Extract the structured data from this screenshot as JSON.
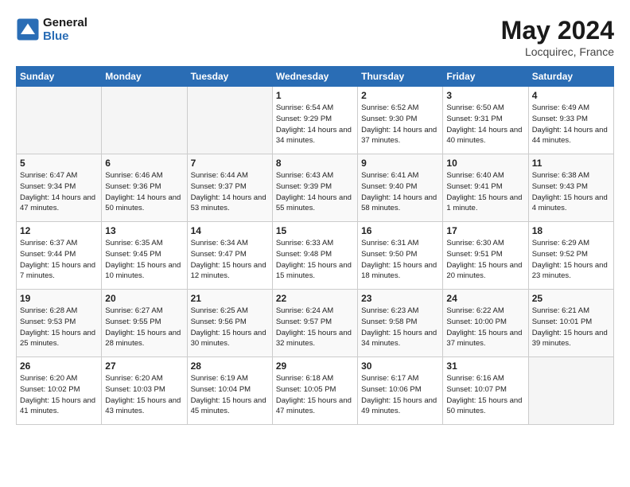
{
  "header": {
    "logo_line1": "General",
    "logo_line2": "Blue",
    "month_year": "May 2024",
    "location": "Locquirec, France"
  },
  "weekdays": [
    "Sunday",
    "Monday",
    "Tuesday",
    "Wednesday",
    "Thursday",
    "Friday",
    "Saturday"
  ],
  "weeks": [
    [
      {
        "day": "",
        "empty": true
      },
      {
        "day": "",
        "empty": true
      },
      {
        "day": "",
        "empty": true
      },
      {
        "day": "1",
        "sunrise": "Sunrise: 6:54 AM",
        "sunset": "Sunset: 9:29 PM",
        "daylight": "Daylight: 14 hours and 34 minutes."
      },
      {
        "day": "2",
        "sunrise": "Sunrise: 6:52 AM",
        "sunset": "Sunset: 9:30 PM",
        "daylight": "Daylight: 14 hours and 37 minutes."
      },
      {
        "day": "3",
        "sunrise": "Sunrise: 6:50 AM",
        "sunset": "Sunset: 9:31 PM",
        "daylight": "Daylight: 14 hours and 40 minutes."
      },
      {
        "day": "4",
        "sunrise": "Sunrise: 6:49 AM",
        "sunset": "Sunset: 9:33 PM",
        "daylight": "Daylight: 14 hours and 44 minutes."
      }
    ],
    [
      {
        "day": "5",
        "sunrise": "Sunrise: 6:47 AM",
        "sunset": "Sunset: 9:34 PM",
        "daylight": "Daylight: 14 hours and 47 minutes."
      },
      {
        "day": "6",
        "sunrise": "Sunrise: 6:46 AM",
        "sunset": "Sunset: 9:36 PM",
        "daylight": "Daylight: 14 hours and 50 minutes."
      },
      {
        "day": "7",
        "sunrise": "Sunrise: 6:44 AM",
        "sunset": "Sunset: 9:37 PM",
        "daylight": "Daylight: 14 hours and 53 minutes."
      },
      {
        "day": "8",
        "sunrise": "Sunrise: 6:43 AM",
        "sunset": "Sunset: 9:39 PM",
        "daylight": "Daylight: 14 hours and 55 minutes."
      },
      {
        "day": "9",
        "sunrise": "Sunrise: 6:41 AM",
        "sunset": "Sunset: 9:40 PM",
        "daylight": "Daylight: 14 hours and 58 minutes."
      },
      {
        "day": "10",
        "sunrise": "Sunrise: 6:40 AM",
        "sunset": "Sunset: 9:41 PM",
        "daylight": "Daylight: 15 hours and 1 minute."
      },
      {
        "day": "11",
        "sunrise": "Sunrise: 6:38 AM",
        "sunset": "Sunset: 9:43 PM",
        "daylight": "Daylight: 15 hours and 4 minutes."
      }
    ],
    [
      {
        "day": "12",
        "sunrise": "Sunrise: 6:37 AM",
        "sunset": "Sunset: 9:44 PM",
        "daylight": "Daylight: 15 hours and 7 minutes."
      },
      {
        "day": "13",
        "sunrise": "Sunrise: 6:35 AM",
        "sunset": "Sunset: 9:45 PM",
        "daylight": "Daylight: 15 hours and 10 minutes."
      },
      {
        "day": "14",
        "sunrise": "Sunrise: 6:34 AM",
        "sunset": "Sunset: 9:47 PM",
        "daylight": "Daylight: 15 hours and 12 minutes."
      },
      {
        "day": "15",
        "sunrise": "Sunrise: 6:33 AM",
        "sunset": "Sunset: 9:48 PM",
        "daylight": "Daylight: 15 hours and 15 minutes."
      },
      {
        "day": "16",
        "sunrise": "Sunrise: 6:31 AM",
        "sunset": "Sunset: 9:50 PM",
        "daylight": "Daylight: 15 hours and 18 minutes."
      },
      {
        "day": "17",
        "sunrise": "Sunrise: 6:30 AM",
        "sunset": "Sunset: 9:51 PM",
        "daylight": "Daylight: 15 hours and 20 minutes."
      },
      {
        "day": "18",
        "sunrise": "Sunrise: 6:29 AM",
        "sunset": "Sunset: 9:52 PM",
        "daylight": "Daylight: 15 hours and 23 minutes."
      }
    ],
    [
      {
        "day": "19",
        "sunrise": "Sunrise: 6:28 AM",
        "sunset": "Sunset: 9:53 PM",
        "daylight": "Daylight: 15 hours and 25 minutes."
      },
      {
        "day": "20",
        "sunrise": "Sunrise: 6:27 AM",
        "sunset": "Sunset: 9:55 PM",
        "daylight": "Daylight: 15 hours and 28 minutes."
      },
      {
        "day": "21",
        "sunrise": "Sunrise: 6:25 AM",
        "sunset": "Sunset: 9:56 PM",
        "daylight": "Daylight: 15 hours and 30 minutes."
      },
      {
        "day": "22",
        "sunrise": "Sunrise: 6:24 AM",
        "sunset": "Sunset: 9:57 PM",
        "daylight": "Daylight: 15 hours and 32 minutes."
      },
      {
        "day": "23",
        "sunrise": "Sunrise: 6:23 AM",
        "sunset": "Sunset: 9:58 PM",
        "daylight": "Daylight: 15 hours and 34 minutes."
      },
      {
        "day": "24",
        "sunrise": "Sunrise: 6:22 AM",
        "sunset": "Sunset: 10:00 PM",
        "daylight": "Daylight: 15 hours and 37 minutes."
      },
      {
        "day": "25",
        "sunrise": "Sunrise: 6:21 AM",
        "sunset": "Sunset: 10:01 PM",
        "daylight": "Daylight: 15 hours and 39 minutes."
      }
    ],
    [
      {
        "day": "26",
        "sunrise": "Sunrise: 6:20 AM",
        "sunset": "Sunset: 10:02 PM",
        "daylight": "Daylight: 15 hours and 41 minutes."
      },
      {
        "day": "27",
        "sunrise": "Sunrise: 6:20 AM",
        "sunset": "Sunset: 10:03 PM",
        "daylight": "Daylight: 15 hours and 43 minutes."
      },
      {
        "day": "28",
        "sunrise": "Sunrise: 6:19 AM",
        "sunset": "Sunset: 10:04 PM",
        "daylight": "Daylight: 15 hours and 45 minutes."
      },
      {
        "day": "29",
        "sunrise": "Sunrise: 6:18 AM",
        "sunset": "Sunset: 10:05 PM",
        "daylight": "Daylight: 15 hours and 47 minutes."
      },
      {
        "day": "30",
        "sunrise": "Sunrise: 6:17 AM",
        "sunset": "Sunset: 10:06 PM",
        "daylight": "Daylight: 15 hours and 49 minutes."
      },
      {
        "day": "31",
        "sunrise": "Sunrise: 6:16 AM",
        "sunset": "Sunset: 10:07 PM",
        "daylight": "Daylight: 15 hours and 50 minutes."
      },
      {
        "day": "",
        "empty": true
      }
    ]
  ]
}
